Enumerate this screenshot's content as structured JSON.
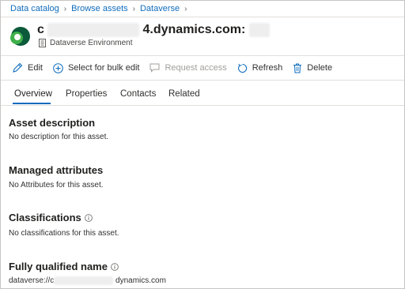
{
  "breadcrumb": [
    "Data catalog",
    "Browse assets",
    "Dataverse"
  ],
  "asset": {
    "title_prefix": "c",
    "title_redacted": "xxxxxxxxxxxxx",
    "title_main": "4.dynamics.com:",
    "title_suffix_redacted": "xxx",
    "type": "Dataverse Environment"
  },
  "toolbar": {
    "edit": "Edit",
    "bulk_edit": "Select for bulk edit",
    "request_access": "Request access",
    "refresh": "Refresh",
    "delete": "Delete"
  },
  "tabs": [
    "Overview",
    "Properties",
    "Contacts",
    "Related"
  ],
  "sections": {
    "description": {
      "title": "Asset description",
      "text": "No description for this asset."
    },
    "managed": {
      "title": "Managed attributes",
      "text": "No Attributes for this asset."
    },
    "classifications": {
      "title": "Classifications",
      "text": "No classifications for this asset."
    },
    "fqn": {
      "title": "Fully qualified name",
      "text_prefix": "dataverse://c",
      "text_redacted": "xxxxxxxxxxxxxxx",
      "text_suffix": " dynamics.com"
    }
  },
  "colors": {
    "accent": "#0f6cbd",
    "logo_dark": "#0b5a3b",
    "logo_light": "#3fb04a"
  }
}
